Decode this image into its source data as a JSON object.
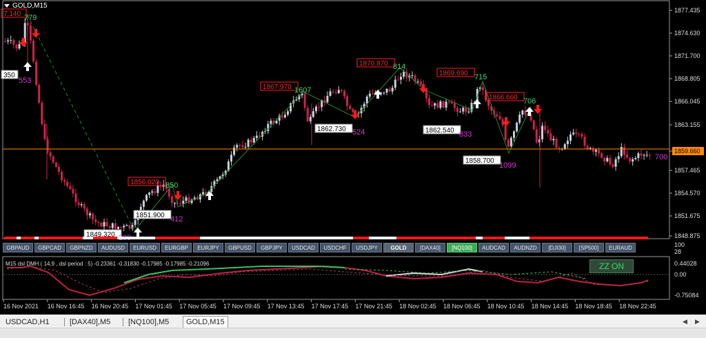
{
  "chart": {
    "title": "GOLD,M15",
    "current_price": "1859.660",
    "price_levels": [
      "1877.435",
      "1874.630",
      "1871.700",
      "1868.805",
      "1866.045",
      "1863.155",
      "1859.660",
      "1857.465",
      "1854.570",
      "1851.675",
      "1848.875"
    ],
    "time_labels": [
      "16 Nov 2021",
      "16 Nov 16:45",
      "16 Nov 20:45",
      "17 Nov 01:45",
      "17 Nov 05:45",
      "17 Nov 09:45",
      "17 Nov 13:45",
      "17 Nov 17:45",
      "17 Nov 21:45",
      "18 Nov 02:45",
      "18 Nov 06:45",
      "18 Nov 10:45",
      "18 Nov 14:45",
      "18 Nov 18:45",
      "18 Nov 22:45"
    ],
    "red_boxes": [
      "7.140",
      "1856.020",
      "1867.970",
      "1870.870",
      "1869.690",
      "1866.660"
    ],
    "white_boxes": [
      "350",
      "1851.900",
      "1849.320",
      "1862.730",
      "1862.540",
      "1858.700"
    ],
    "green_labels": [
      "779",
      "850",
      "1607",
      "814",
      "715",
      "706"
    ],
    "magenta_labels": [
      "553",
      "412",
      "524",
      "833",
      "1099",
      "700",
      "299"
    ]
  },
  "symbols": [
    "GBPAUD",
    "GBPCAD",
    "GBPNZD",
    "AUDUSD",
    "EURUSD",
    "EURGBP",
    "EURJPY",
    "GBPUSD",
    "GBPJPY",
    "USDCAD",
    "USDCHF",
    "USDJPY",
    "GOLD",
    "[DAX40]",
    "[NQ100]",
    "AUDCAD",
    "AUDNZD",
    "[DJI30]",
    "[SP500]",
    "EURAUD"
  ],
  "indicator": {
    "label": "M15 dsl DMH ( 14,9 , dsl period : 5) -0.23361 -0.31830 -0.17985 -0.17985 -0.21096",
    "scale_top": [
      "100",
      "28"
    ],
    "levels": [
      "0.44028",
      "0.00",
      "-0.75084"
    ],
    "zz_button": "ZZ ON"
  },
  "tabs": [
    "USDCAD,H1",
    "[DAX40],M5",
    "[NQ100],M5",
    "GOLD,M15"
  ],
  "active_tab": "GOLD,M15",
  "colors": {
    "bull": "#c8d0dc",
    "bear": "#d0224c",
    "current_line": "#ff8c00",
    "zz_green": "#3bd96b"
  }
}
